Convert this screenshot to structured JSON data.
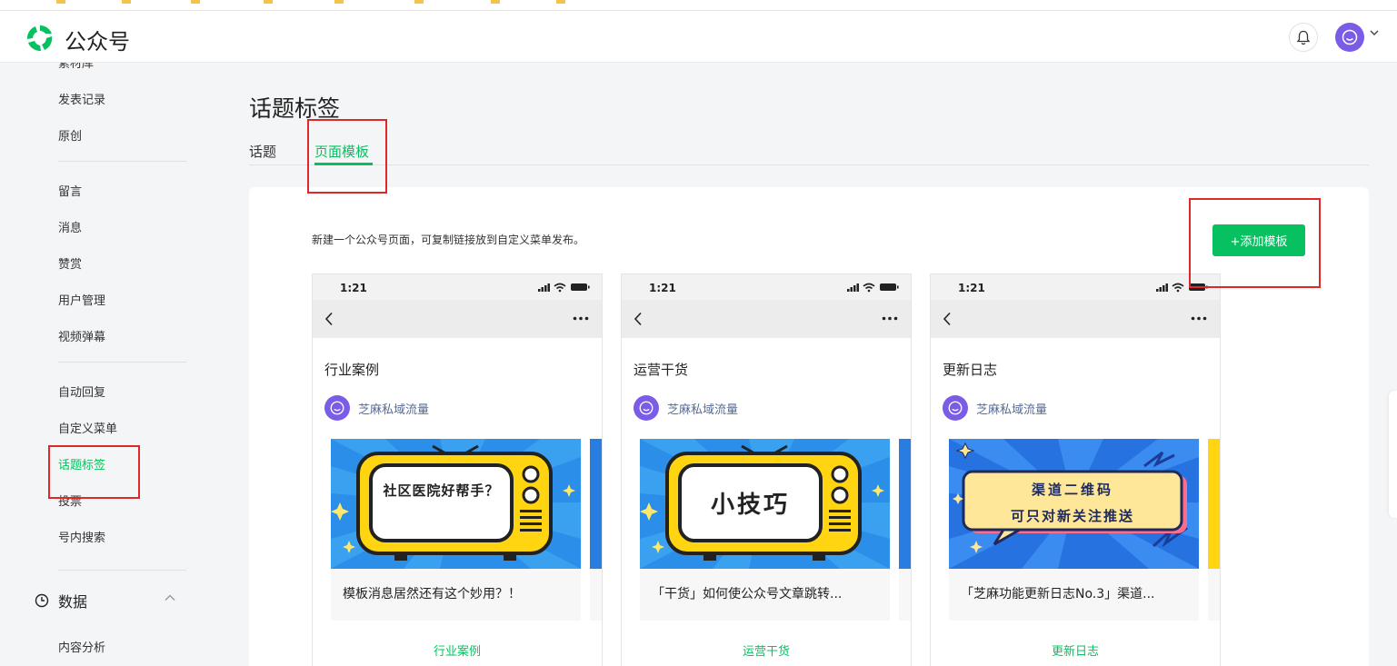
{
  "app": {
    "name": "公众号"
  },
  "sidebar": {
    "items": [
      {
        "label": "素材库",
        "active": false
      },
      {
        "label": "发表记录",
        "active": false
      },
      {
        "label": "原创",
        "active": false
      },
      {
        "label": "留言",
        "active": false
      },
      {
        "label": "消息",
        "active": false
      },
      {
        "label": "赞赏",
        "active": false
      },
      {
        "label": "用户管理",
        "active": false
      },
      {
        "label": "视频弹幕",
        "active": false
      },
      {
        "label": "自动回复",
        "active": false
      },
      {
        "label": "自定义菜单",
        "active": false
      },
      {
        "label": "话题标签",
        "active": true
      },
      {
        "label": "投票",
        "active": false
      },
      {
        "label": "号内搜索",
        "active": false
      },
      {
        "label": "内容分析",
        "active": false
      }
    ],
    "section_data": {
      "label": "数据",
      "icon": "clock-icon",
      "expanded": true
    }
  },
  "page": {
    "title": "话题标签",
    "tabs": [
      {
        "label": "话题",
        "active": false
      },
      {
        "label": "页面模板",
        "active": true
      }
    ],
    "description": "新建一个公众号页面，可复制链接放到自定义菜单发布。",
    "add_button": "+添加模板"
  },
  "cards": [
    {
      "time": "1:21",
      "title": "行业案例",
      "author": "芝麻私域流量",
      "cover_text": "社区医院好帮手？",
      "caption": "模板消息居然还有这个妙用？！",
      "footer": "行业案例"
    },
    {
      "time": "1:21",
      "title": "运营干货",
      "author": "芝麻私域流量",
      "cover_text": "小技巧",
      "caption": "「干货」如何使公众号文章跳转...",
      "footer": "运营干货"
    },
    {
      "time": "1:21",
      "title": "更新日志",
      "author": "芝麻私域流量",
      "cover_text_line1": "渠道二维码",
      "cover_text_line2": "可只对新关注推送",
      "caption": "「芝麻功能更新日志No.3」渠道...",
      "footer": "更新日志"
    }
  ],
  "colors": {
    "accent": "#07c160",
    "highlight": "#e02828",
    "avatar": "#7b5ce6"
  }
}
